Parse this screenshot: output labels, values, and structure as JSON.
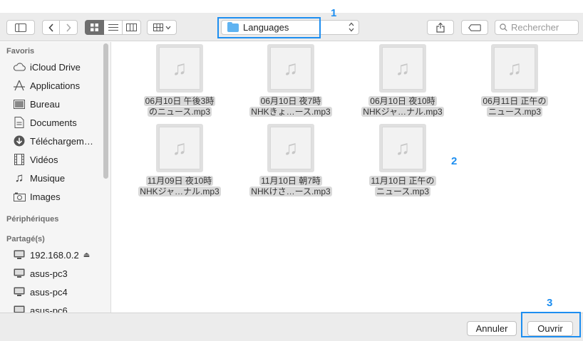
{
  "toolbar": {
    "path_label": "Languages",
    "search_placeholder": "Rechercher"
  },
  "callouts": [
    "1",
    "2",
    "3"
  ],
  "sidebar": {
    "favorites_header": "Favoris",
    "favorites": [
      {
        "label": "iCloud Drive",
        "icon": "cloud-icon"
      },
      {
        "label": "Applications",
        "icon": "applications-icon"
      },
      {
        "label": "Bureau",
        "icon": "desktop-icon"
      },
      {
        "label": "Documents",
        "icon": "document-icon"
      },
      {
        "label": "Téléchargem…",
        "icon": "download-icon"
      },
      {
        "label": "Vidéos",
        "icon": "film-icon"
      },
      {
        "label": "Musique",
        "icon": "music-icon"
      },
      {
        "label": "Images",
        "icon": "camera-icon"
      }
    ],
    "devices_header": "Périphériques",
    "shared_header": "Partagé(s)",
    "shared": [
      {
        "label": "192.168.0.2",
        "icon": "monitor-icon"
      },
      {
        "label": "asus-pc3",
        "icon": "monitor-icon"
      },
      {
        "label": "asus-pc4",
        "icon": "monitor-icon"
      },
      {
        "label": "asus-pc6",
        "icon": "monitor-icon"
      }
    ]
  },
  "files": [
    {
      "line1": "06月10日 午後3時",
      "line2": "のニュース.mp3"
    },
    {
      "line1": "06月10日 夜7時",
      "line2": "NHKきょ…ース.mp3"
    },
    {
      "line1": "06月10日 夜10時",
      "line2": "NHKジャ…ナル.mp3"
    },
    {
      "line1": "06月11日 正午の",
      "line2": "ニュース.mp3"
    },
    {
      "line1": "11月09日 夜10時",
      "line2": "NHKジャ…ナル.mp3"
    },
    {
      "line1": "11月10日 朝7時",
      "line2": "NHKけさ…ース.mp3"
    },
    {
      "line1": "11月10日 正午の",
      "line2": "ニュース.mp3"
    }
  ],
  "buttons": {
    "cancel": "Annuler",
    "open": "Ouvrir"
  },
  "colors": {
    "highlight": "#1d8ef0",
    "folder": "#5fb3f1"
  }
}
